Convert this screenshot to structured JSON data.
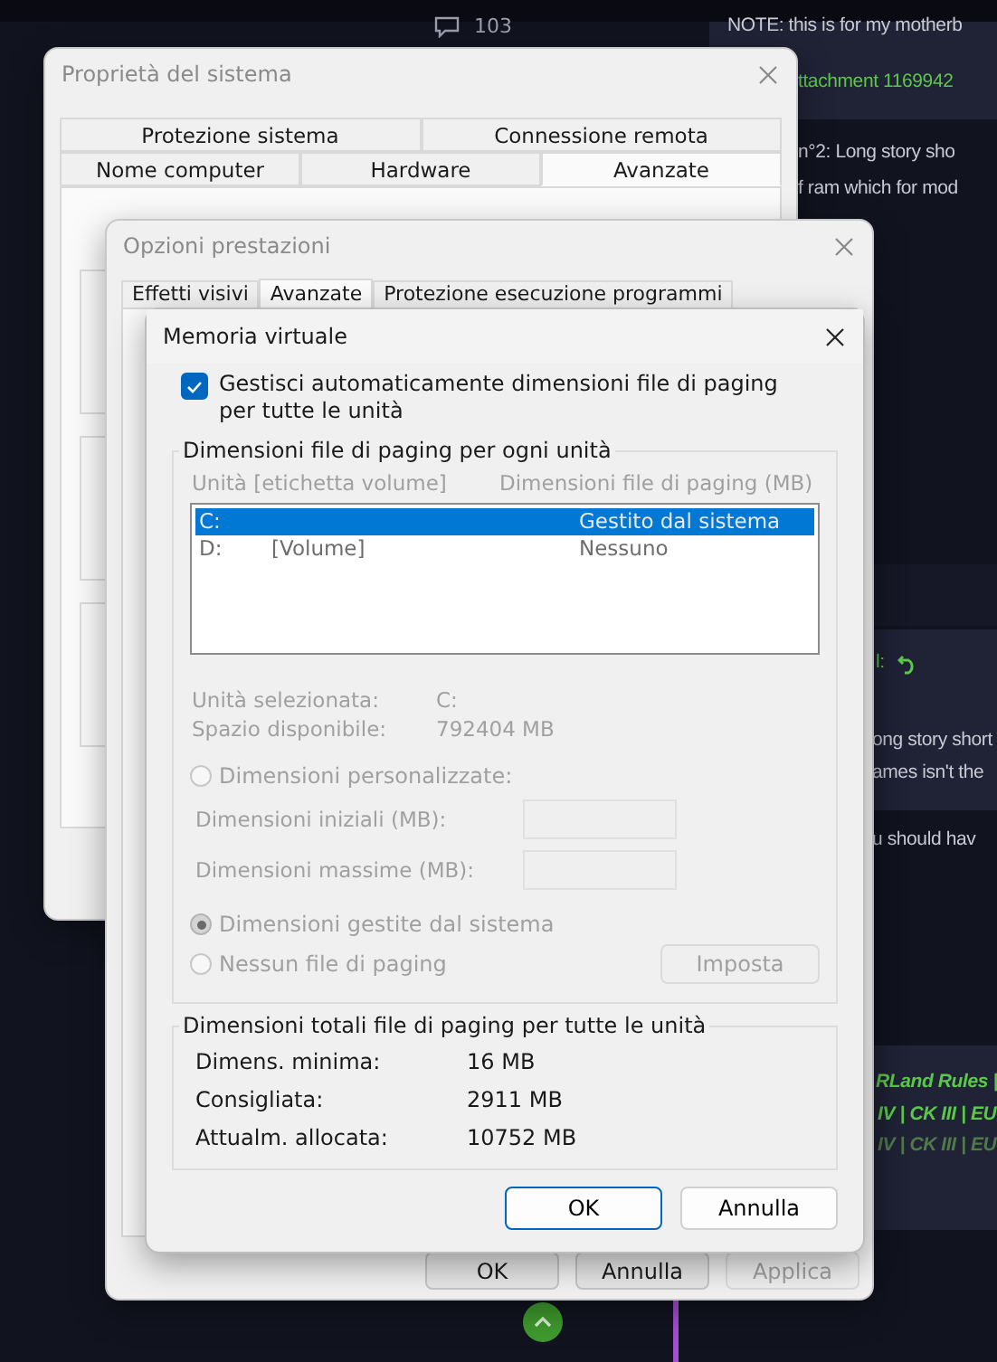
{
  "forum": {
    "reply_count": "103",
    "snippets": [
      {
        "text": "NOTE: this is for my motherb",
        "kind": "plain"
      },
      {
        "text": "ttachment 1169942",
        "kind": "link"
      },
      {
        "text": "n°2: Long story sho",
        "kind": "plain"
      },
      {
        "text": "f ram which for mod",
        "kind": "plain"
      },
      {
        "text": "l:",
        "kind": "link"
      },
      {
        "text": "ong story short",
        "kind": "plain"
      },
      {
        "text": "ames isn't the",
        "kind": "plain"
      },
      {
        "text": "u should hav",
        "kind": "plain"
      },
      {
        "text": "RLand Rules |",
        "kind": "signature"
      },
      {
        "text": "IV | CK III | EU",
        "kind": "signature"
      },
      {
        "text": "IV | CK III | EU",
        "kind": "faded"
      }
    ]
  },
  "system_properties": {
    "title": "Proprietà del sistema",
    "tab_rows": [
      [
        {
          "label": "Protezione sistema",
          "selected": false
        },
        {
          "label": "Connessione remota",
          "selected": false
        }
      ],
      [
        {
          "label": "Nome computer",
          "selected": false
        },
        {
          "label": "Hardware",
          "selected": false
        },
        {
          "label": "Avanzate",
          "selected": true
        }
      ]
    ]
  },
  "performance_options": {
    "title": "Opzioni prestazioni",
    "tabs": [
      {
        "label": "Effetti visivi",
        "selected": false
      },
      {
        "label": "Avanzate",
        "selected": true
      },
      {
        "label": "Protezione esecuzione programmi",
        "selected": false
      }
    ],
    "buttons": [
      {
        "label": "OK",
        "disabled": false
      },
      {
        "label": "Annulla",
        "disabled": false
      },
      {
        "label": "Applica",
        "disabled": true
      }
    ]
  },
  "virtual_memory": {
    "title": "Memoria virtuale",
    "auto_manage": {
      "label": "Gestisci automaticamente dimensioni file di paging per tutte le unità",
      "checked": true
    },
    "drives_group": {
      "legend": "Dimensioni file di paging per ogni unità",
      "disabled": true,
      "columns": [
        "Unità [etichetta volume]",
        "Dimensioni file di paging (MB)"
      ],
      "drives": [
        {
          "drive": "C:",
          "size": "Gestito dal sistema",
          "selected": true
        },
        {
          "drive": "D:",
          "volume": "[Volume]",
          "size": "Nessuno",
          "selected": false
        }
      ],
      "info": [
        {
          "label": "Unità selezionata:",
          "value": "C:"
        },
        {
          "label": "Spazio disponibile:",
          "value": "792404 MB"
        }
      ],
      "custom_option": {
        "label": "Dimensioni personalizzate:",
        "selected": false
      },
      "fields": [
        {
          "label": "Dimensioni iniziali (MB):"
        },
        {
          "label": "Dimensioni massime (MB):"
        }
      ],
      "other_options": [
        {
          "label": "Dimensioni gestite dal sistema",
          "selected": true
        },
        {
          "label": "Nessun file di paging",
          "selected": false
        }
      ],
      "set_button": "Imposta"
    },
    "totals_group": {
      "legend": "Dimensioni totali file di paging per tutte le unità",
      "rows": [
        {
          "label": "Dimens. minima:",
          "value": "16 MB"
        },
        {
          "label": "Consigliata:",
          "value": "2911 MB"
        },
        {
          "label": "Attualm. allocata:",
          "value": "10752 MB"
        }
      ]
    },
    "buttons": [
      {
        "label": "OK",
        "focused": true
      },
      {
        "label": "Annulla",
        "focused": false
      }
    ]
  }
}
